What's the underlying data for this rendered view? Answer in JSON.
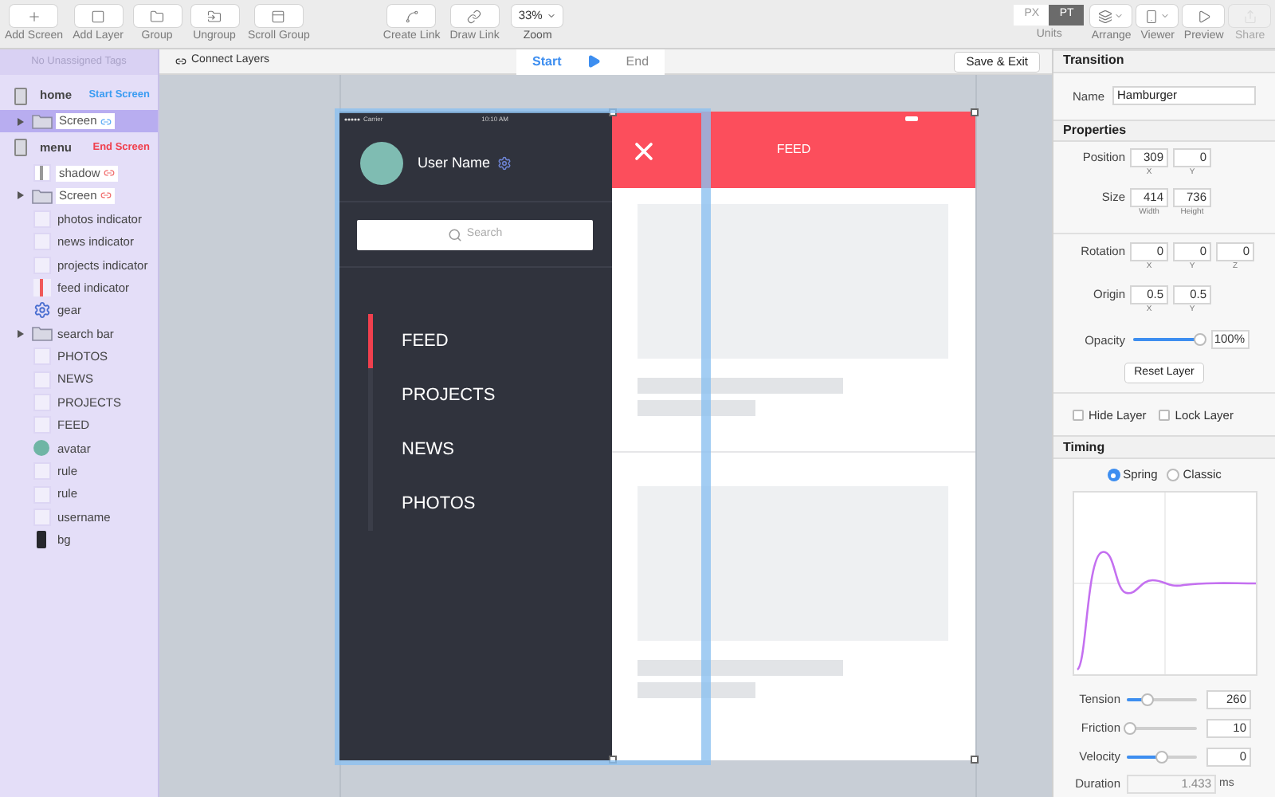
{
  "toolbar": {
    "tools": [
      {
        "kind": "add",
        "label": "Add Screen"
      },
      {
        "kind": "layer",
        "label": "Add Layer"
      },
      {
        "kind": "group",
        "label": "Group"
      },
      {
        "kind": "ungroup",
        "label": "Ungroup"
      },
      {
        "kind": "scroll",
        "label": "Scroll Group"
      }
    ],
    "link_tools": [
      {
        "kind": "create",
        "label": "Create Link"
      },
      {
        "kind": "draw",
        "label": "Draw Link"
      }
    ],
    "zoom": {
      "value": "33%",
      "label": "Zoom"
    },
    "units": {
      "label": "Units",
      "options": [
        {
          "label": "PX",
          "selected": false
        },
        {
          "label": "PT",
          "selected": true
        }
      ]
    },
    "right_tools": [
      {
        "kind": "arrange",
        "label": "Arrange",
        "disabled": false
      },
      {
        "kind": "viewer",
        "label": "Viewer",
        "disabled": false
      },
      {
        "kind": "preview",
        "label": "Preview",
        "disabled": false
      },
      {
        "kind": "share",
        "label": "Share",
        "disabled": true
      }
    ]
  },
  "layers_panel": {
    "header": "No Unassigned Tags",
    "screens": [
      {
        "name": "home",
        "tag": "Start Screen",
        "color": "#3b9cf2",
        "selected": false,
        "children": [
          {
            "name": "Screen",
            "kind": "group",
            "expanded": false,
            "linked": true,
            "selected": true
          }
        ]
      },
      {
        "name": "menu",
        "tag": "End Screen",
        "color": "#f0404e",
        "selected": false,
        "children": [
          {
            "name": "shadow",
            "kind": "shadow",
            "linked": true,
            "selected": false
          },
          {
            "name": "Screen",
            "kind": "group",
            "expanded": false,
            "linked": true,
            "selected": false
          },
          {
            "name": "photos indicator",
            "kind": "layer",
            "linked": false,
            "selected": false
          },
          {
            "name": "news indicator",
            "kind": "layer",
            "linked": false,
            "selected": false
          },
          {
            "name": "projects indicator",
            "kind": "layer",
            "linked": false,
            "selected": false
          },
          {
            "name": "feed indicator",
            "kind": "indicator",
            "linked": false,
            "selected": false
          },
          {
            "name": "gear",
            "kind": "gear",
            "linked": false,
            "selected": false
          },
          {
            "name": "search bar",
            "kind": "group",
            "expanded": false,
            "linked": false,
            "selected": false
          },
          {
            "name": "PHOTOS",
            "kind": "layer",
            "linked": false,
            "selected": false
          },
          {
            "name": "NEWS",
            "kind": "layer",
            "linked": false,
            "selected": false
          },
          {
            "name": "PROJECTS",
            "kind": "layer",
            "linked": false,
            "selected": false
          },
          {
            "name": "FEED",
            "kind": "layer",
            "linked": false,
            "selected": false
          },
          {
            "name": "avatar",
            "kind": "avatar",
            "linked": false,
            "selected": false
          },
          {
            "name": "rule",
            "kind": "layer",
            "linked": false,
            "selected": false
          },
          {
            "name": "rule",
            "kind": "layer",
            "linked": false,
            "selected": false
          },
          {
            "name": "username",
            "kind": "layer",
            "linked": false,
            "selected": false
          },
          {
            "name": "bg",
            "kind": "bg",
            "linked": false,
            "selected": false
          }
        ]
      }
    ]
  },
  "canvas": {
    "connect_label": "Connect Layers",
    "states": [
      {
        "label": "Start",
        "selected": true
      },
      {
        "label": "End",
        "selected": false
      }
    ],
    "save_label": "Save & Exit",
    "menu_screen": {
      "carrier": "Carrier",
      "time": "10:10 AM",
      "user_name": "User Name",
      "search_placeholder": "Search",
      "nav": [
        {
          "label": "FEED",
          "selected": true
        },
        {
          "label": "PROJECTS",
          "selected": false
        },
        {
          "label": "NEWS",
          "selected": false
        },
        {
          "label": "PHOTOS",
          "selected": false
        }
      ]
    },
    "feed_screen": {
      "title": "FEED"
    }
  },
  "inspector": {
    "transition_header": "Transition",
    "name_label": "Name",
    "name_value": "Hamburger",
    "properties_header": "Properties",
    "rows": [
      {
        "label": "Position",
        "fields": [
          {
            "value": "309",
            "caption": "X"
          },
          {
            "value": "0",
            "caption": "Y"
          }
        ]
      },
      {
        "label": "Size",
        "fields": [
          {
            "value": "414",
            "caption": "Width"
          },
          {
            "value": "736",
            "caption": "Height"
          }
        ]
      },
      {
        "label": "Rotation",
        "fields": [
          {
            "value": "0",
            "caption": "X"
          },
          {
            "value": "0",
            "caption": "Y"
          },
          {
            "value": "0",
            "caption": "Z"
          }
        ]
      },
      {
        "label": "Origin",
        "fields": [
          {
            "value": "0.5",
            "caption": "X"
          },
          {
            "value": "0.5",
            "caption": "Y"
          }
        ]
      }
    ],
    "opacity": {
      "label": "Opacity",
      "level": 0.95,
      "value": "100%"
    },
    "reset_label": "Reset Layer",
    "checks": [
      {
        "label": "Hide Layer",
        "checked": false
      },
      {
        "label": "Lock Layer",
        "checked": false
      }
    ],
    "timing_header": "Timing",
    "modes": [
      {
        "label": "Spring",
        "selected": true
      },
      {
        "label": "Classic",
        "selected": false
      }
    ],
    "sliders": [
      {
        "label": "Tension",
        "level": 0.3,
        "value": "260"
      },
      {
        "label": "Friction",
        "level": 0.05,
        "value": "10"
      },
      {
        "label": "Velocity",
        "level": 0.5,
        "value": "0"
      }
    ],
    "duration": {
      "label": "Duration",
      "value": "1.433",
      "unit": "ms"
    }
  }
}
